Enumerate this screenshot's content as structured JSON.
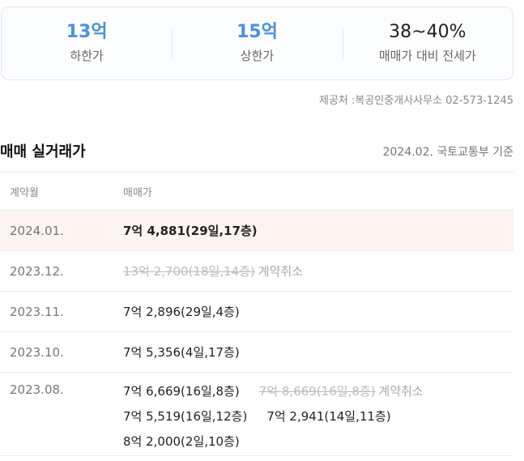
{
  "summary": {
    "lower": {
      "value": "13억",
      "label": "하한가"
    },
    "upper": {
      "value": "15억",
      "label": "상한가"
    },
    "ratio": {
      "value": "38~40%",
      "label": "매매가 대비 전세가"
    }
  },
  "provider": "제공처 :복공인중개사사무소 02-573-1245",
  "section": {
    "title": "매매 실거래가",
    "basis": "2024.02. 국토교통부 기준"
  },
  "table": {
    "headers": {
      "month": "계약월",
      "price": "매매가"
    },
    "rows": [
      {
        "month": "2024.01.",
        "deal1": "7억 4,881(29일,17층)"
      },
      {
        "month": "2023.12.",
        "cancelled": "13억 2,700(18일,14층)",
        "tag": "계약취소"
      },
      {
        "month": "2023.11.",
        "deal1": "7억 2,896(29일,4층)"
      },
      {
        "month": "2023.10.",
        "deal1": "7억 5,356(4일,17층)"
      },
      {
        "month": "2023.08.",
        "deal1": "7억 6,669(16일,8층)",
        "cancelled": "7억 8,669(16일,8층)",
        "tag": "계약취소",
        "deal2": "7억 5,519(16일,12층)",
        "deal3": "7억 2,941(14일,11층)",
        "deal4": "8억 2,000(2일,10층)"
      }
    ]
  }
}
